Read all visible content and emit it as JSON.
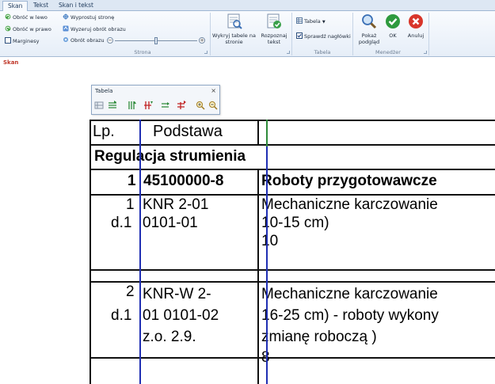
{
  "tabs": [
    "Skan",
    "Tekst",
    "Skan i tekst"
  ],
  "ribbon": {
    "rotate_left": "Obróć w lewo",
    "rotate_right": "Obróć w prawo",
    "margins": "Marginesy",
    "straighten": "Wyprostuj stronę",
    "reset_rotation": "Wyzeruj obrót obrazu",
    "image_rotation": "Obrót obrazu",
    "detect_tables": "Wykryj tabele na stronie",
    "recognize_text": "Rozpoznaj tekst",
    "table_menu": "Tabela",
    "check_headers": "Sprawdź nagłówki",
    "show_preview": "Pokaż podgląd",
    "ok": "OK",
    "cancel": "Anuluj",
    "groups": {
      "page": "Strona",
      "table": "Tabela",
      "manager": "Menedżer"
    }
  },
  "status": {
    "label": "Skan"
  },
  "float_toolbar": {
    "title": "Tabela",
    "close": "×"
  },
  "scan": {
    "h_lp": "Lp.",
    "h_basis": "Podstawa",
    "section": "Regulacja strumienia",
    "r1_lp": "1",
    "r1_code": "45100000-8",
    "r1_desc": "Roboty przygotowawcze",
    "r2_lp1": "1",
    "r2_lp2": "d.1",
    "r2_b1": "KNR 2-01",
    "r2_b2": "0101-01",
    "r2_d1": "Mechaniczne karczowanie",
    "r2_d2": "10-15 cm)",
    "r2_d3": "10",
    "r3_lp1": "2",
    "r3_lp2": "d.1",
    "r3_b1": "KNR-W 2-",
    "r3_b2": "01 0101-02",
    "r3_b3": "z.o. 2.9.",
    "r3_d1": "Mechaniczne karczowanie",
    "r3_d2": "16-25 cm) - roboty wykony",
    "r3_d3": "zmianę roboczą )",
    "r3_d4": "8"
  },
  "colors": {
    "accent_red": "#c0392b",
    "guide_blue": "#1f2fb3",
    "guide_green": "#2e8b3a"
  }
}
